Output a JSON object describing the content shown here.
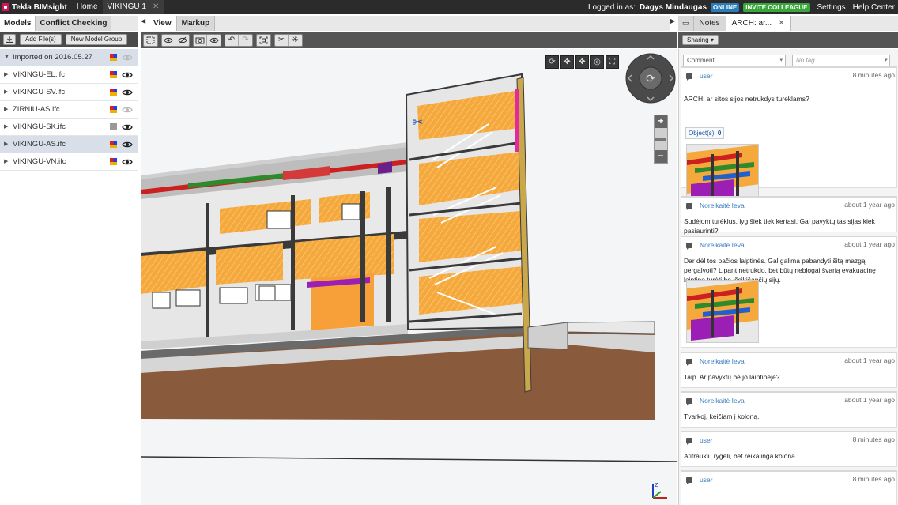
{
  "app": {
    "name": "Tekla BIMsight"
  },
  "top_tabs": [
    {
      "label": "Home"
    },
    {
      "label": "VIKINGU 1"
    }
  ],
  "top_right": {
    "logged_in_label": "Logged in as:",
    "user_name": "Dagys Mindaugas",
    "status_badge": "ONLINE",
    "invite_button": "INVITE COLLEAGUE",
    "settings": "Settings",
    "help": "Help Center"
  },
  "left_panel": {
    "tabs": [
      {
        "label": "Models"
      },
      {
        "label": "Conflict Checking"
      }
    ],
    "toolbar": {
      "add_files": "Add File(s)",
      "new_group": "New Model Group"
    },
    "group": {
      "label": "Imported on 2016.05.27"
    },
    "models": [
      {
        "name": "VIKINGU-EL.ifc",
        "swatch": "multi",
        "visible": true,
        "selected": false
      },
      {
        "name": "VIKINGU-SV.ifc",
        "swatch": "multi",
        "visible": true,
        "selected": false
      },
      {
        "name": "ZIRNIU-AS.ifc",
        "swatch": "multi",
        "visible": false,
        "selected": false
      },
      {
        "name": "VIKINGU-SK.ifc",
        "swatch": "gray",
        "visible": true,
        "selected": false
      },
      {
        "name": "VIKINGU-AS.ifc",
        "swatch": "multi",
        "visible": true,
        "selected": true
      },
      {
        "name": "VIKINGU-VN.ifc",
        "swatch": "multi",
        "visible": true,
        "selected": false
      }
    ]
  },
  "view_tabs": [
    {
      "label": "View"
    },
    {
      "label": "Markup"
    }
  ],
  "right_panel": {
    "tabs": [
      {
        "label": "Notes"
      },
      {
        "label": "ARCH: ar..."
      }
    ],
    "toolbar": {
      "sharing": "Sharing"
    },
    "filters": {
      "type": "Comment",
      "tag_placeholder": "No tag"
    },
    "notes": [
      {
        "author": "user",
        "time": "8 minutes ago",
        "text": "ARCH: ar sitos sijos netrukdys tureklams?",
        "objects_label": "Object(s):",
        "objects_count": "0"
      },
      {
        "author": "Noreikaitė Ieva",
        "time": "about 1 year ago",
        "text": "Sudėjom turėklus, lyg šiek tiek kertasi. Gal pavyktų tas sijas kiek pasiaurinti?"
      },
      {
        "author": "Noreikaitė Ieva",
        "time": "about 1 year ago",
        "text": "Dar dėl tos pačios laiptinės. Gal galima pabandyti šitą mazgą pergalvoti? Lipant netrukdo, bet būtų neblogai švarią evakuacinę laiptinę turėti be išsikišančių sijų."
      },
      {
        "author": "Noreikaitė Ieva",
        "time": "about 1 year ago",
        "text": "Taip. Ar pavyktų be jo laiptinėje?"
      },
      {
        "author": "Noreikaitė Ieva",
        "time": "about 1 year ago",
        "text": "Tvarkoj, keičiam į koloną."
      },
      {
        "author": "user",
        "time": "8 minutes ago",
        "text": "Atitraukiu rygeli, bet reikalinga kolona"
      },
      {
        "author": "user",
        "time": "8 minutes ago",
        "text": ""
      }
    ]
  },
  "colors": {
    "accent": "#3a7bbf",
    "online": "#2b7bb9",
    "invite": "#3aa53a",
    "wall_orange": "#f5a93c",
    "ground": "#8a5a3c"
  },
  "icons": [
    "download-icon",
    "eye-icon",
    "select-box-icon",
    "undo-icon",
    "redo-icon",
    "fit-icon",
    "clip-icon",
    "orbit-icon",
    "pan-icon",
    "zoom-in-icon",
    "zoom-out-icon",
    "axis-icon",
    "comment-icon"
  ]
}
